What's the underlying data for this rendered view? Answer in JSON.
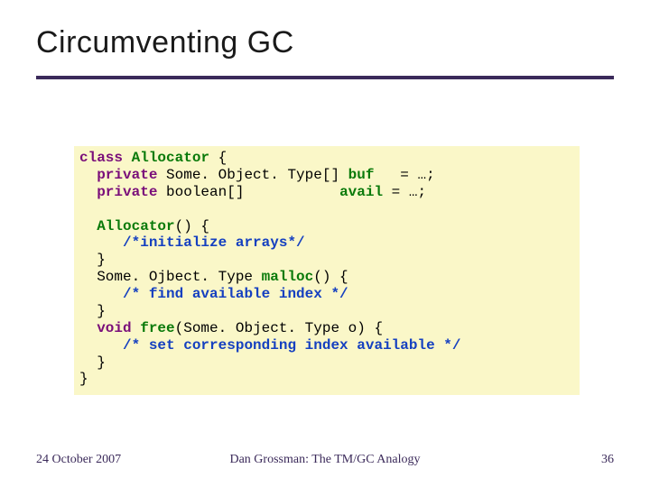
{
  "title": "Circumventing GC",
  "code": {
    "l1a": "class",
    "l1b": " ",
    "l1c": "Allocator",
    "l1d": " {",
    "l2a": "  ",
    "l2b": "private",
    "l2c": " Some. Object. Type[] ",
    "l2d": "buf",
    "l2e": "   = …;",
    "l3a": "  ",
    "l3b": "private",
    "l3c": " boolean[]           ",
    "l3d": "avail",
    "l3e": " = …;",
    "blank1": "",
    "l4a": "  ",
    "l4b": "Allocator",
    "l4c": "() {",
    "l5a": "     ",
    "l5b": "/*initialize arrays*/",
    "l6": "  }",
    "l7a": "  Some. Ojbect. Type ",
    "l7b": "malloc",
    "l7c": "() {",
    "l8a": "     ",
    "l8b": "/* find available index */",
    "l9": "  }",
    "l10a": "  ",
    "l10b": "void",
    "l10c": " ",
    "l10d": "free",
    "l10e": "(Some. Object. Type o) {",
    "l11a": "     ",
    "l11b": "/* set corresponding index available */",
    "l12": "  }",
    "l13": "}"
  },
  "footer": {
    "left": "24 October 2007",
    "center": "Dan Grossman: The TM/GC Analogy",
    "right": "36"
  }
}
